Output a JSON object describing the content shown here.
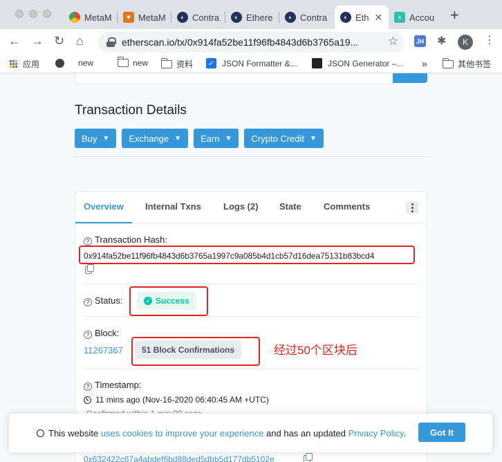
{
  "browser": {
    "tabs": [
      {
        "label": "MetaM",
        "icon": "chrome-icon",
        "color": "#ea4335"
      },
      {
        "label": "MetaM",
        "icon": "metamask-fox-icon",
        "color": "#e2761b"
      },
      {
        "label": "Contra",
        "icon": "etherscan-icon",
        "color": "#21325b"
      },
      {
        "label": "Ethere",
        "icon": "etherscan-icon",
        "color": "#21325b"
      },
      {
        "label": "Contra",
        "icon": "etherscan-icon",
        "color": "#21325b"
      },
      {
        "label": "Eth",
        "icon": "etherscan-icon",
        "color": "#21325b",
        "active": true
      },
      {
        "label": "Accou",
        "icon": "app-icon",
        "color": "#2bc0a7"
      }
    ],
    "new_tab": "+",
    "url": "etherscan.io/tx/0x914fa52be11f96fb4843d6b3765a19...",
    "profile_initial": "K",
    "extension_label": "JH",
    "bookmarks": [
      {
        "label": "应用",
        "icon": "apps-grid-icon"
      },
      {
        "label": "new",
        "icon": "globe-icon"
      },
      {
        "label": "new",
        "icon": "folder-icon"
      },
      {
        "label": "资料",
        "icon": "folder-icon"
      },
      {
        "label": "JSON Formatter &...",
        "icon": "checkbox-icon"
      },
      {
        "label": "JSON Generator –...",
        "icon": "json-generator-icon"
      }
    ],
    "bookmarks_overflow": "»",
    "other_bookmarks": "其他书签"
  },
  "page": {
    "title": "Transaction Details",
    "action_buttons": [
      "Buy",
      "Exchange",
      "Earn",
      "Crypto Credit"
    ],
    "card_tabs": [
      "Overview",
      "Internal Txns",
      "Logs (2)",
      "State",
      "Comments"
    ],
    "active_tab": "Overview",
    "fields": {
      "hash_label": "Transaction Hash:",
      "hash_value": "0x914fa52be11f96fb4843d6b3765a1997c9a085b4d1cb57d16dea75131b83bcd4",
      "status_label": "Status:",
      "status_value": "Success",
      "block_label": "Block:",
      "block_number": "11267367",
      "block_confirmations": "51 Block Confirmations",
      "timestamp_label": "Timestamp:",
      "timestamp_value": "11 mins ago (Nov-16-2020 06:40:45 AM +UTC)",
      "confirmed_within": "Confirmed within 1 min:00 secs",
      "partial_hash": "0x632422c67a4abdef6bd88ded5dbb5d177db5102e"
    },
    "annotation": "经过50个区块后",
    "annotation_color": "#e0261f",
    "accent_color": "#3498db",
    "success_color": "#00c9a7"
  },
  "cookie_banner": {
    "text_before": "This website ",
    "link1": "uses cookies to improve your experience",
    "text_middle": " and has an updated ",
    "link2": "Privacy Policy",
    "text_after": ".",
    "button": "Got It"
  }
}
